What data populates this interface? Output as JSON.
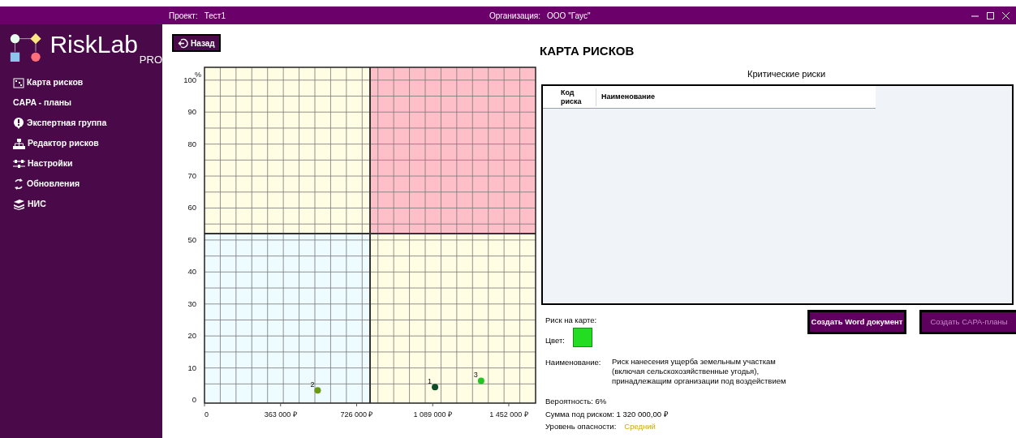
{
  "title_bar": {
    "project_label": "Проект:",
    "project": "Тест1",
    "org_label": "Организация:",
    "org": "ООО \"Гаус\""
  },
  "logo": {
    "name": "RiskLab",
    "edition": "PRO"
  },
  "sidebar": {
    "items": [
      {
        "label": "Карта рисков"
      },
      {
        "label": "CAPA - планы"
      },
      {
        "label": "Экспертная группа"
      },
      {
        "label": "Редактор рисков"
      },
      {
        "label": "Настройки"
      },
      {
        "label": "Обновления"
      },
      {
        "label": "НИС"
      }
    ]
  },
  "back_button": "Назад",
  "page_title": "КАРТА РИСКОВ",
  "chart": {
    "risk_zones": [
      {
        "color": "#fffde3"
      },
      {
        "color": "#ffbfc8"
      },
      {
        "color": "#eefbff"
      },
      {
        "color": "#fffde3"
      }
    ],
    "chart_data": {
      "type": "scatter",
      "grid": true,
      "ylabel": "%",
      "ref_lines": [
        {
          "axis": "x",
          "value": 790000
        },
        {
          "axis": "y",
          "value": 52
        }
      ],
      "xlim": [
        0,
        1580000
      ],
      "ylim": [
        -1,
        104
      ],
      "xticks": [
        {
          "value": 0,
          "label": "0"
        },
        {
          "value": 363000,
          "label": "363 000 ₽"
        },
        {
          "value": 726000,
          "label": "726 000 ₽"
        },
        {
          "value": 1089000,
          "label": "1 089 000 ₽"
        },
        {
          "value": 1452000,
          "label": "1 452 000 ₽"
        }
      ],
      "yticks": [
        0,
        10,
        20,
        30,
        40,
        50,
        60,
        70,
        80,
        90,
        100
      ],
      "series": [
        {
          "name": "1",
          "color": "#0b4d2a",
          "x": [
            1100000
          ],
          "values": [
            4
          ]
        },
        {
          "name": "2",
          "color": "#6a9a12",
          "x": [
            540000
          ],
          "values": [
            3
          ]
        },
        {
          "name": "3",
          "color": "#22c522",
          "x": [
            1320000
          ],
          "values": [
            6
          ]
        }
      ]
    }
  },
  "critical_risks": {
    "title": "Критические риски",
    "columns": [
      "Код риска",
      "Наименование"
    ]
  },
  "buttons": [
    {
      "label": "Создать Word документ",
      "disabled": false
    },
    {
      "label": "Создать CAPA-планы",
      "disabled": true
    }
  ],
  "details": {
    "heading": "Риск на карте:",
    "color_label": "Цвет:",
    "color": "#22dd22",
    "name_label": "Наименование:",
    "name": "Риск нанесения ущерба земельным участкам (включая сельскохозяйственные угодья), принадлежащим организации под воздействием",
    "probability": "Вероятность: 6%",
    "sum": "Сумма под риском: 1 320 000,00 ₽",
    "level_label": "Уровень опасности:",
    "level": "Средний"
  }
}
